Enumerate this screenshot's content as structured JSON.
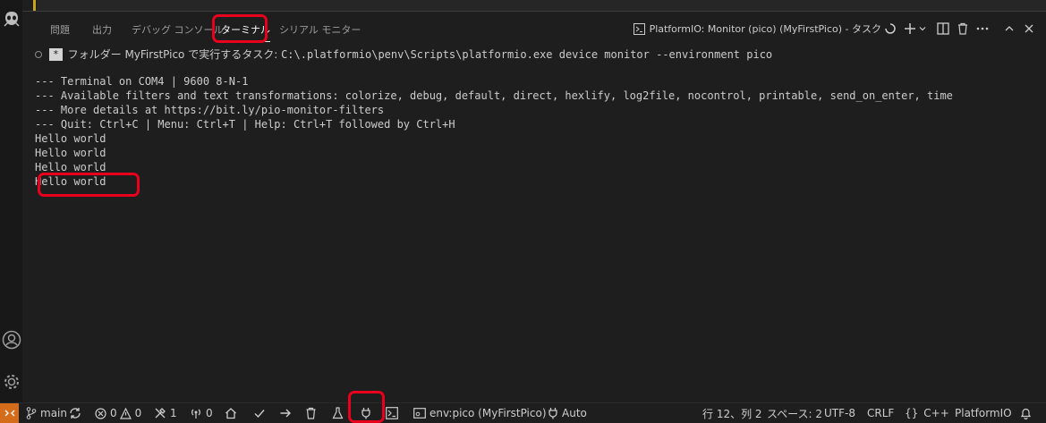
{
  "panel": {
    "tabs": [
      "問題",
      "出力",
      "デバッグ コンソール",
      "ターミナル",
      "シリアル モニター"
    ],
    "active_tab": "ターミナル",
    "terminal_title": "PlatformIO: Monitor (pico) (MyFirstPico) - タスク"
  },
  "terminal": {
    "task_star": "*",
    "task_prefix": "フォルダー MyFirstPico で実行するタスク: ",
    "task_cmd": "C:\\.platformio\\penv\\Scripts\\platformio.exe device monitor --environment pico",
    "lines": [
      "--- Terminal on COM4 | 9600 8-N-1",
      "--- Available filters and text transformations: colorize, debug, default, direct, hexlify, log2file, nocontrol, printable, send_on_enter, time",
      "--- More details at https://bit.ly/pio-monitor-filters",
      "--- Quit: Ctrl+C | Menu: Ctrl+T | Help: Ctrl+T followed by Ctrl+H",
      "Hello world",
      "Hello world",
      "Hello world",
      "Hello world"
    ]
  },
  "status": {
    "branch": "main",
    "errors": "0",
    "warnings": "0",
    "tools": "1",
    "ports": "0",
    "env": "env:pico (MyFirstPico)",
    "auto": "Auto",
    "position": "行 12、列 2",
    "spaces": "スペース: 2",
    "encoding": "UTF-8",
    "eol": "CRLF",
    "language": "C++",
    "platform": "PlatformIO"
  },
  "colors": {
    "accent_red": "#e8001c",
    "remote_orange": "#d56c1a",
    "background": "#1e1e1e"
  }
}
